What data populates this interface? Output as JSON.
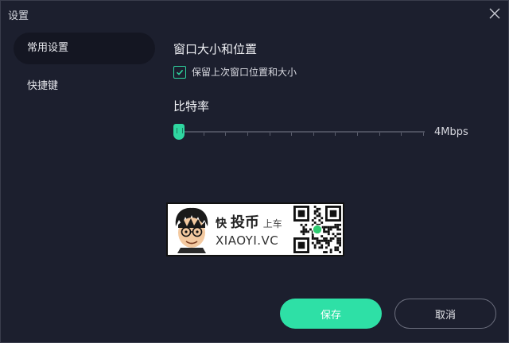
{
  "window": {
    "title": "设置",
    "close_icon": "close-icon"
  },
  "sidebar": {
    "items": [
      {
        "label": "常用设置",
        "active": true
      },
      {
        "label": "快捷键",
        "active": false
      }
    ]
  },
  "main": {
    "window_section": {
      "title": "窗口大小和位置",
      "remember_checkbox": {
        "label": "保留上次窗口位置和大小",
        "checked": true
      }
    },
    "bitrate_section": {
      "title": "比特率",
      "slider": {
        "value_label": "4Mbps",
        "position_fraction": 0.0,
        "tick_count": 12
      }
    }
  },
  "watermark": {
    "line1_a": "快",
    "line1_b": "投币",
    "line1_c": "上车",
    "line2": "XIAOYI.VC"
  },
  "buttons": {
    "save": "保存",
    "cancel": "取消"
  },
  "colors": {
    "background": "#1c1f2e",
    "sidebar_active": "#141622",
    "accent": "#2ee0a6",
    "text": "#e8e9ee"
  }
}
